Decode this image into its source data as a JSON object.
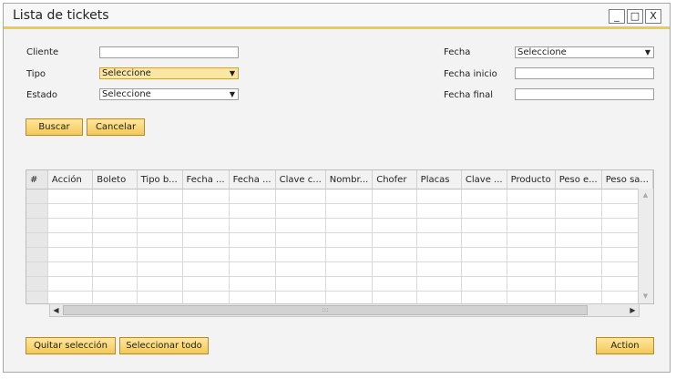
{
  "window": {
    "title": "Lista de tickets",
    "controls": [
      "_",
      "□",
      "X"
    ]
  },
  "form": {
    "cliente_label": "Cliente",
    "cliente_value": "",
    "tipo_label": "Tipo",
    "tipo_value": "Seleccione",
    "estado_label": "Estado",
    "estado_value": "Seleccione",
    "fecha_label": "Fecha",
    "fecha_value": "Seleccione",
    "fecha_inicio_label": "Fecha inicio",
    "fecha_inicio_value": "",
    "fecha_final_label": "Fecha final",
    "fecha_final_value": ""
  },
  "buttons": {
    "buscar": "Buscar",
    "cancelar": "Cancelar",
    "quitar": "Quitar selección",
    "seleccionar": "Seleccionar todo",
    "action": "Action"
  },
  "grid": {
    "columns": [
      "#",
      "Acción",
      "Boleto",
      "Tipo b...",
      "Fecha ...",
      "Fecha ...",
      "Clave c...",
      "Nombr...",
      "Chofer",
      "Placas",
      "Clave ...",
      "Producto",
      "Peso e...",
      "Peso sa..."
    ],
    "row_count": 8,
    "scroll_grip": ":::"
  },
  "colors": {
    "accent": "#f2c94c",
    "button": "#f3c85b",
    "active_field": "#fbe7a1"
  }
}
